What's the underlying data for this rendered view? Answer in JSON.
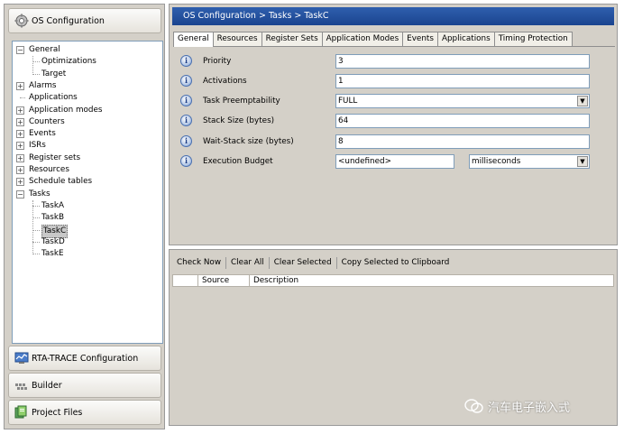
{
  "left_panel": {
    "header": "OS Configuration",
    "tree": [
      {
        "label": "General",
        "level": 0,
        "expander": "minus"
      },
      {
        "label": "Optimizations",
        "level": 1
      },
      {
        "label": "Target",
        "level": 1
      },
      {
        "label": "Alarms",
        "level": 0,
        "expander": "plus"
      },
      {
        "label": "Applications",
        "level": 0
      },
      {
        "label": "Application modes",
        "level": 0,
        "expander": "plus"
      },
      {
        "label": "Counters",
        "level": 0,
        "expander": "plus"
      },
      {
        "label": "Events",
        "level": 0,
        "expander": "plus"
      },
      {
        "label": "ISRs",
        "level": 0,
        "expander": "plus"
      },
      {
        "label": "Register sets",
        "level": 0,
        "expander": "plus"
      },
      {
        "label": "Resources",
        "level": 0,
        "expander": "plus"
      },
      {
        "label": "Schedule tables",
        "level": 0,
        "expander": "plus"
      },
      {
        "label": "Tasks",
        "level": 0,
        "expander": "minus"
      },
      {
        "label": "TaskA",
        "level": 1
      },
      {
        "label": "TaskB",
        "level": 1
      },
      {
        "label": "TaskC",
        "level": 1,
        "selected": true
      },
      {
        "label": "TaskD",
        "level": 1
      },
      {
        "label": "TaskE",
        "level": 1
      }
    ],
    "nav_buttons": [
      "RTA-TRACE Configuration",
      "Builder",
      "Project Files"
    ]
  },
  "config_panel": {
    "breadcrumb": "OS Configuration  >  Tasks  >  TaskC",
    "tabs": [
      "General",
      "Resources",
      "Register Sets",
      "Application Modes",
      "Events",
      "Applications",
      "Timing Protection"
    ],
    "active_tab": "General",
    "properties": [
      {
        "label": "Priority",
        "value": "3",
        "type": "text"
      },
      {
        "label": "Activations",
        "value": "1",
        "type": "text"
      },
      {
        "label": "Task Preemptability",
        "value": "FULL",
        "type": "select"
      },
      {
        "label": "Stack Size (bytes)",
        "value": "64",
        "type": "text"
      },
      {
        "label": "Wait-Stack size (bytes)",
        "value": "8",
        "type": "text"
      },
      {
        "label": "Execution Budget",
        "value": "<undefined>",
        "type": "text",
        "unit": "milliseconds"
      }
    ]
  },
  "results_panel": {
    "toolbar": [
      "Check Now",
      "Clear All",
      "Clear Selected",
      "Copy Selected to Clipboard"
    ],
    "columns": [
      "",
      "Source",
      "Description"
    ]
  },
  "watermark": "汽车电子嵌入式"
}
